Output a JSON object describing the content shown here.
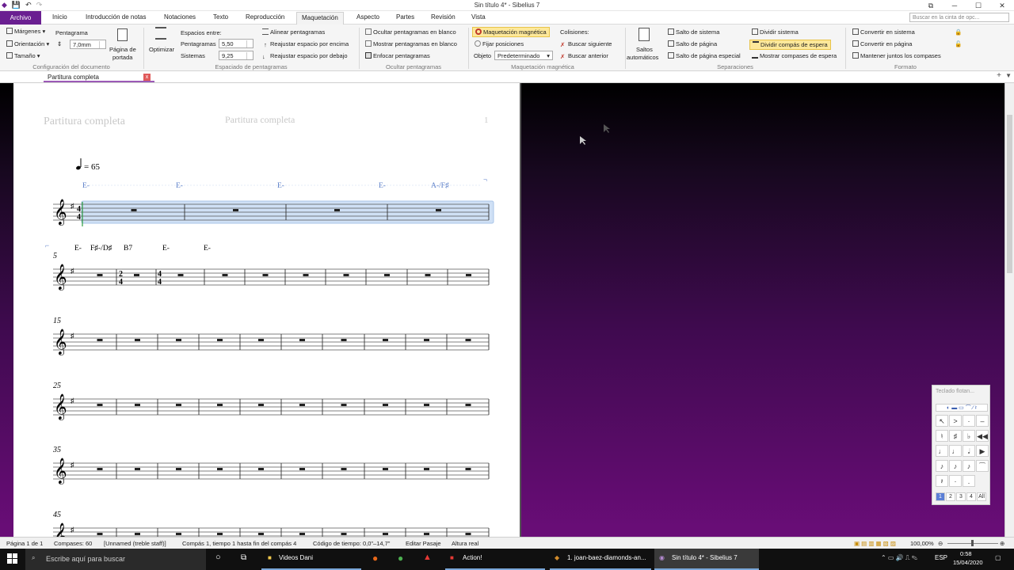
{
  "window": {
    "title": "Sin título 4* - Sibelius 7",
    "minimize": "─",
    "maximize": "☐",
    "close": "✕",
    "restore": "⧉"
  },
  "tabs": {
    "file": "Archivo",
    "items": [
      "Inicio",
      "Introducción de notas",
      "Notaciones",
      "Texto",
      "Reproducción",
      "Maquetación",
      "Aspecto",
      "Partes",
      "Revisión",
      "Vista"
    ],
    "active": "Maquetación"
  },
  "search": {
    "placeholder": "Buscar en la cinta de opc..."
  },
  "ribbon": {
    "doc_setup": {
      "margins": "Márgenes",
      "orientation": "Orientación",
      "size": "Tamaño",
      "staff_label": "Pentagrama",
      "staff_size": "7,0mm",
      "page_label_1": "Página de",
      "page_label_2": "portada",
      "group": "Configuración del documento"
    },
    "staff_spacing": {
      "optimize": "Optimizar",
      "spaces_between": "Espacios entre:",
      "staves_label": "Pentagramas",
      "staves_value": "5,50",
      "systems_label": "Sistemas",
      "systems_value": "9,25",
      "align": "Alinear pentagramas",
      "reset_above": "Reajustar espacio por encima",
      "reset_below": "Reajustar espacio por debajo",
      "group": "Espaciado de pentagramas"
    },
    "hide_staves": {
      "hide_empty": "Ocultar pentagramas en blanco",
      "show_empty": "Mostrar pentagramas en blanco",
      "focus": "Enfocar pentagramas",
      "group": "Ocultar pentagramas"
    },
    "magnetic": {
      "magnetic_layout": "Maquetación magnética",
      "fix_positions": "Fijar posiciones",
      "object_label": "Objeto",
      "object_value": "Predeterminado",
      "collisions": "Colisiones:",
      "find_next": "Buscar siguiente",
      "find_prev": "Buscar anterior",
      "group": "Maquetación magnética"
    },
    "breaks": {
      "auto_1": "Saltos",
      "auto_2": "automáticos",
      "system_break": "Salto de sistema",
      "page_break": "Salto de página",
      "special_page_break": "Salto de página especial",
      "split_system": "Dividir sistema",
      "split_multirest": "Dividir compás de espera",
      "show_multirests": "Mostrar compases de espera",
      "group": "Separaciones"
    },
    "format": {
      "make_system": "Convertir en sistema",
      "make_page": "Convertir en página",
      "keep_together": "Mantener juntos los compases",
      "group": "Formato"
    }
  },
  "document_tab": {
    "label": "Partitura completa",
    "close": "x"
  },
  "score": {
    "header_left": "Partitura completa",
    "header_center": "Partitura completa",
    "page_number": "1",
    "tempo": "= 65",
    "systems": [
      {
        "bar": "",
        "chords": [
          {
            "text": "E-"
          },
          {
            "text": "E-"
          },
          {
            "text": "E-"
          },
          {
            "text": "E-"
          },
          {
            "text": "A-/F♯"
          }
        ]
      },
      {
        "bar": "5",
        "chords": [
          {
            "text": "E-"
          },
          {
            "text": "F♯-/D♯"
          },
          {
            "text": "B7"
          },
          {
            "text": "E-"
          },
          {
            "text": "E-"
          }
        ]
      },
      {
        "bar": "15",
        "chords": []
      },
      {
        "bar": "25",
        "chords": []
      },
      {
        "bar": "35",
        "chords": []
      },
      {
        "bar": "45",
        "chords": []
      }
    ]
  },
  "keypad": {
    "title": "Teclado flotan...",
    "keys": [
      "↖",
      ">",
      "·",
      "–",
      "♮",
      "♯",
      "♭",
      "◀◀",
      "♩",
      "♩",
      "𝅗𝅥",
      "▶",
      "♪",
      "♪",
      "♪",
      "⁀",
      "𝄽",
      "·",
      "."
    ],
    "layouts": [
      "1",
      "2",
      "3",
      "4",
      "All"
    ]
  },
  "status": {
    "page": "Página 1 de 1",
    "bars": "Compases: 60",
    "instrument": "[Unnamed (treble staff)]",
    "selection": "Compás 1, tiempo 1 hasta fin del compás 4",
    "timecode": "Código de tiempo: 0,0\"–14,7\"",
    "mode": "Editar Pasaje",
    "pitch": "Altura real",
    "zoom": "100,00%"
  },
  "taskbar": {
    "search_placeholder": "Escribe aquí para buscar",
    "apps": [
      "Videos Dani",
      "Action!",
      "1. joan-baez-diamonds-an...",
      "Sin título 4* - Sibelius 7"
    ],
    "lang": "ESP",
    "time": "0:58",
    "date": "15/04/2020"
  },
  "colors": {
    "accent": "#6a1f91",
    "selection": "#cfe0f5",
    "chord": "#5a7ec8",
    "header_text": "#c8c8c8"
  }
}
